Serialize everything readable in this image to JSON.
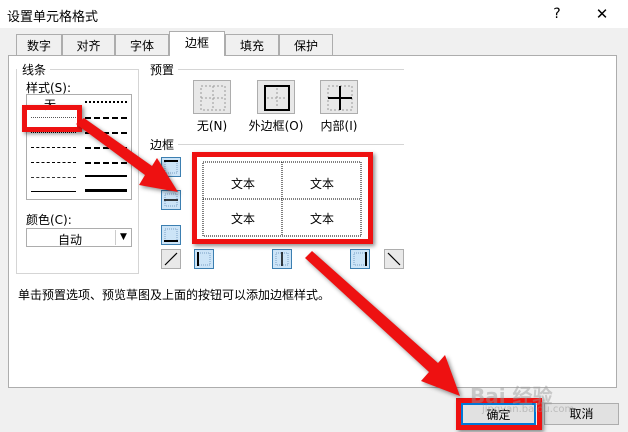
{
  "window": {
    "title": "设置单元格格式",
    "help_label": "?",
    "close_label": "✕"
  },
  "tabs": [
    {
      "label": "数字",
      "active": false
    },
    {
      "label": "对齐",
      "active": false
    },
    {
      "label": "字体",
      "active": false
    },
    {
      "label": "边框",
      "active": true
    },
    {
      "label": "填充",
      "active": false
    },
    {
      "label": "保护",
      "active": false
    }
  ],
  "line": {
    "group_label": "线条",
    "style_label": "样式(S):",
    "none_label": "无",
    "color_label": "颜色(C):",
    "color_value": "自动"
  },
  "presets": {
    "group_label": "预置",
    "items": [
      {
        "label": "无(N)",
        "icon": "preset-none-icon"
      },
      {
        "label": "外边框(O)",
        "icon": "preset-outline-icon"
      },
      {
        "label": "内部(I)",
        "icon": "preset-inside-icon"
      }
    ]
  },
  "border": {
    "group_label": "边框",
    "preview_cells": [
      "文本",
      "文本",
      "文本",
      "文本"
    ]
  },
  "hint": "单击预置选项、预览草图及上面的按钮可以添加边框样式。",
  "buttons": {
    "ok": "确定",
    "cancel": "取消"
  },
  "watermark": {
    "text": "Bai 经验",
    "subtext": "jingyan.baidu.com"
  },
  "colors": {
    "annotation": "#ee1111",
    "accent": "#0078d7",
    "dialog_bg": "#f0f0f0"
  }
}
